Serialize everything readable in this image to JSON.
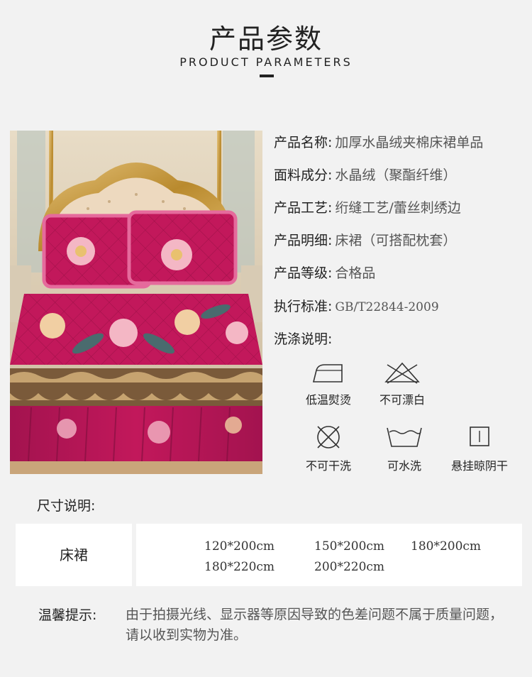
{
  "header": {
    "title": "产品参数",
    "subtitle": "PRODUCT PARAMETERS"
  },
  "params": [
    {
      "label": "产品名称:",
      "value": "加厚水晶绒夹棉床裙单品"
    },
    {
      "label": "面料成分:",
      "value": "水晶绒（聚酯纤维）"
    },
    {
      "label": "产品工艺:",
      "value": "绗缝工艺/蕾丝刺绣边"
    },
    {
      "label": "产品明细:",
      "value": "床裙（可搭配枕套）"
    },
    {
      "label": "产品等级:",
      "value": "合格品"
    },
    {
      "label": "执行标准:",
      "value": "GB/T22844-2009"
    },
    {
      "label": "洗涤说明:",
      "value": ""
    }
  ],
  "care": [
    {
      "icon": "iron-low-icon",
      "label": "低温熨烫"
    },
    {
      "icon": "no-bleach-icon",
      "label": "不可漂白"
    },
    {
      "icon": "no-dry-clean-icon",
      "label": "不可干洗"
    },
    {
      "icon": "hand-wash-icon",
      "label": "可水洗"
    },
    {
      "icon": "line-dry-shade-icon",
      "label": "悬挂晾阴干"
    }
  ],
  "size": {
    "heading": "尺寸说明:",
    "item": "床裙",
    "values": [
      "120*200cm",
      "150*200cm",
      "180*200cm",
      "180*220cm",
      "200*220cm"
    ]
  },
  "notice": {
    "label": "温馨提示:",
    "text": "由于拍摄光线、显示器等原因导致的色差问题不属于质量问题，请以收到实物为准。"
  },
  "colors": {
    "background": "#f2f2f2",
    "fabric": "#c2185b",
    "fabric_dark": "#8e1346",
    "gold": "#c79a3b"
  }
}
